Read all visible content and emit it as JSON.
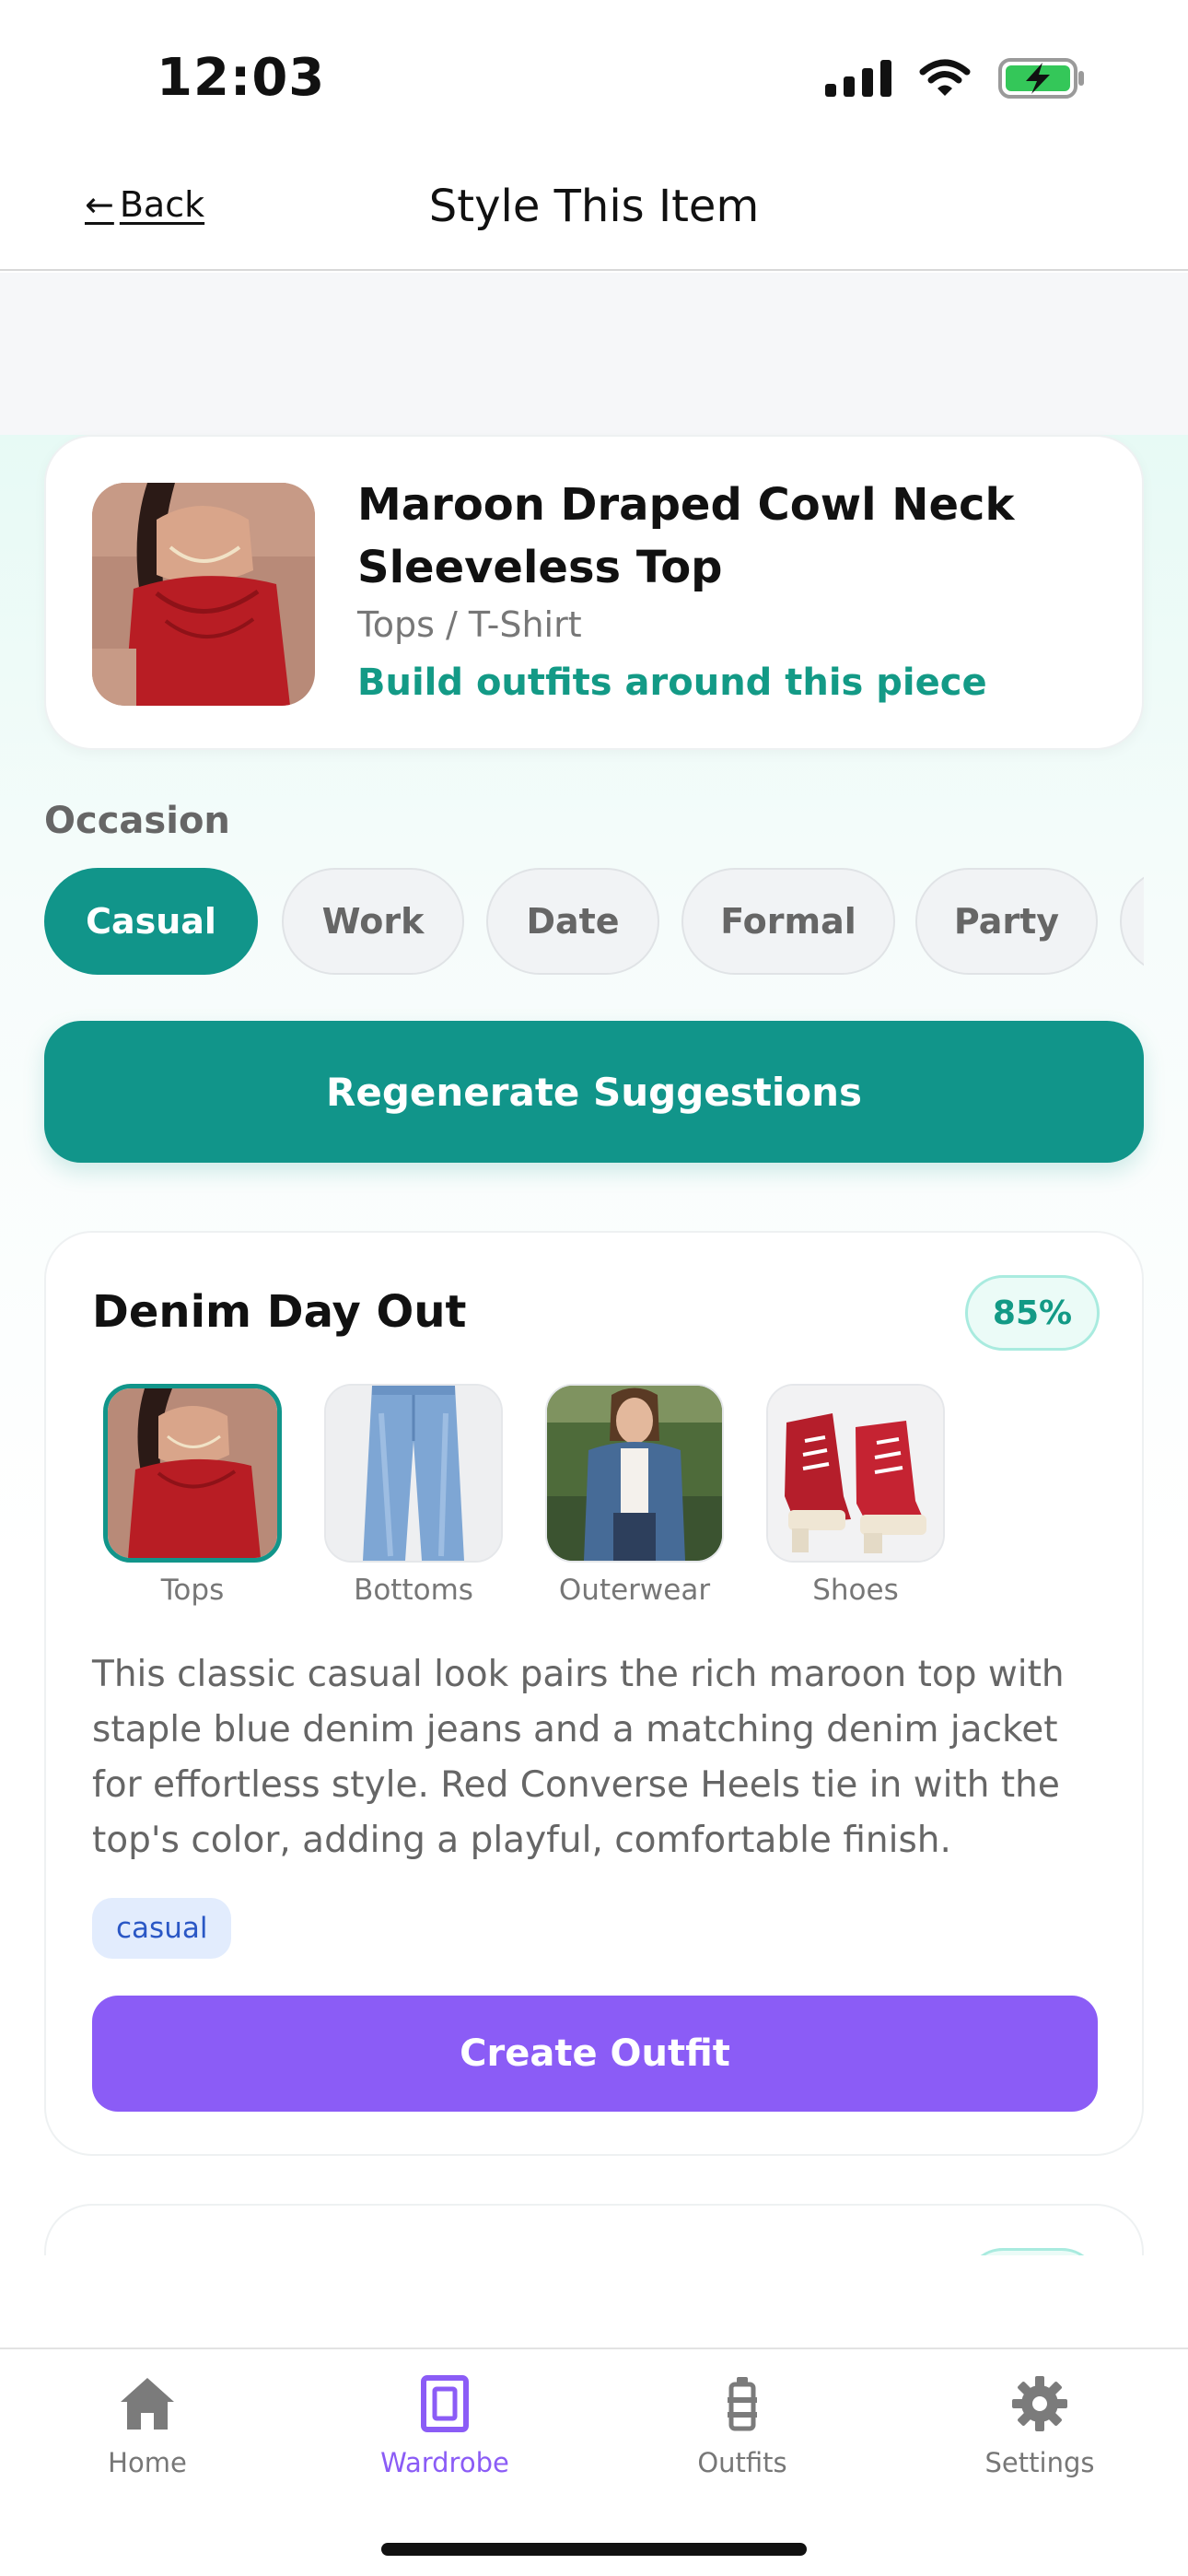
{
  "status_bar": {
    "time": "12:03"
  },
  "nav": {
    "back_label": "Back",
    "title": "Style This Item"
  },
  "item": {
    "name": "Maroon Draped Cowl Neck Sleeveless Top",
    "category": "Tops / T-Shirt",
    "cta": "Build outfits around this piece"
  },
  "occasion": {
    "label": "Occasion",
    "options": [
      "Casual",
      "Work",
      "Date",
      "Formal",
      "Party"
    ],
    "selected": "Casual"
  },
  "regenerate_label": "Regenerate Suggestions",
  "outfits": [
    {
      "title": "Denim Day Out",
      "score": "85%",
      "pieces": [
        {
          "label": "Tops",
          "icon": "maroon-top-photo"
        },
        {
          "label": "Bottoms",
          "icon": "blue-jeans-photo"
        },
        {
          "label": "Outerwear",
          "icon": "denim-jacket-photo"
        },
        {
          "label": "Shoes",
          "icon": "red-converse-heels-photo"
        }
      ],
      "description": "This classic casual look pairs the rich maroon top with staple blue denim jeans and a matching denim jacket for effortless style. Red Converse Heels tie in with the top's color, adding a playful, comfortable finish.",
      "tags": [
        "casual"
      ],
      "create_label": "Create Outfit"
    }
  ],
  "tabs": [
    {
      "label": "Home",
      "icon": "home-icon"
    },
    {
      "label": "Wardrobe",
      "icon": "wardrobe-icon",
      "active": true
    },
    {
      "label": "Outfits",
      "icon": "outfits-icon"
    },
    {
      "label": "Settings",
      "icon": "gear-icon"
    }
  ],
  "colors": {
    "accent_teal": "#11958a",
    "accent_purple": "#8b5cf6",
    "tag_blue": "#2a57c5"
  }
}
